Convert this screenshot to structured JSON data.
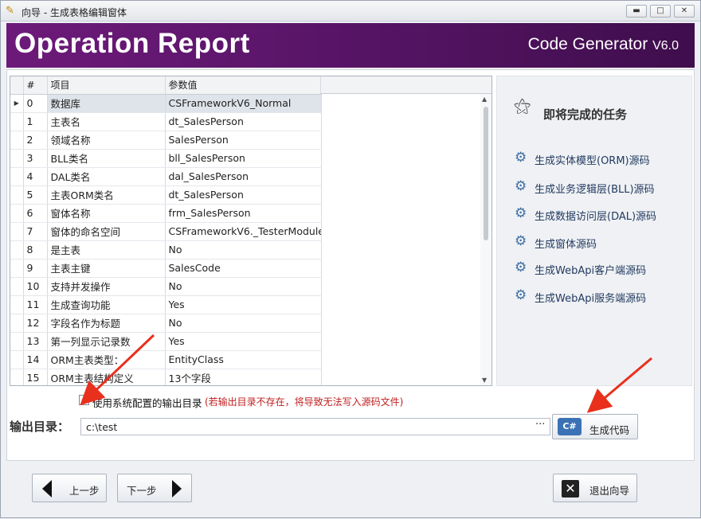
{
  "window": {
    "title": "向导 - 生成表格编辑窗体",
    "min_glyph": "▬",
    "max_glyph": "□",
    "close_glyph": "✕"
  },
  "banner": {
    "title": "Operation Report",
    "subtitle": "Code Generator",
    "version": "V6.0"
  },
  "grid": {
    "columns": [
      "#",
      "项目",
      "参数值"
    ],
    "rows": [
      {
        "no": "0",
        "item": "数据库",
        "value": "CSFrameworkV6_Normal"
      },
      {
        "no": "1",
        "item": "主表名",
        "value": "dt_SalesPerson"
      },
      {
        "no": "2",
        "item": "领域名称",
        "value": "SalesPerson"
      },
      {
        "no": "3",
        "item": "BLL类名",
        "value": "bll_SalesPerson"
      },
      {
        "no": "4",
        "item": "DAL类名",
        "value": "dal_SalesPerson"
      },
      {
        "no": "5",
        "item": "主表ORM类名",
        "value": "dt_SalesPerson"
      },
      {
        "no": "6",
        "item": "窗体名称",
        "value": "frm_SalesPerson"
      },
      {
        "no": "7",
        "item": "窗体的命名空间",
        "value": "CSFrameworkV6._TesterModule"
      },
      {
        "no": "8",
        "item": "是主表",
        "value": "No"
      },
      {
        "no": "9",
        "item": "主表主键",
        "value": "SalesCode"
      },
      {
        "no": "10",
        "item": "支持并发操作",
        "value": "No"
      },
      {
        "no": "11",
        "item": "生成查询功能",
        "value": "Yes"
      },
      {
        "no": "12",
        "item": "字段名作为标题",
        "value": "No"
      },
      {
        "no": "13",
        "item": "第一列显示记录数",
        "value": "Yes"
      },
      {
        "no": "14",
        "item": "ORM主表类型：",
        "value": "EntityClass"
      },
      {
        "no": "15",
        "item": "ORM主表结构定义",
        "value": "13个字段"
      }
    ],
    "selected_row": 0
  },
  "tasks": {
    "heading": "即将完成的任务",
    "items": [
      "生成实体模型(ORM)源码",
      "生成业务逻辑层(BLL)源码",
      "生成数据访问层(DAL)源码",
      "生成窗体源码",
      "生成WebApi客户端源码",
      "生成WebApi服务端源码"
    ]
  },
  "options": {
    "use_system_dir_label": "使用系统配置的输出目录",
    "use_system_dir_checked": false,
    "warning": "(若输出目录不存在，将导致无法写入源码文件)"
  },
  "output": {
    "label": "输出目录：",
    "value": "c:\\test",
    "browse_glyph": "···"
  },
  "buttons": {
    "generate": "生成代码",
    "generate_icon_text": "C#",
    "prev": "上一步",
    "next": "下一步",
    "exit": "退出向导",
    "exit_icon_text": "✕"
  },
  "colors": {
    "banner": "#5a1669",
    "arrow": "#e8301c",
    "warning": "#c02020",
    "gear": "#3f6fa3"
  }
}
